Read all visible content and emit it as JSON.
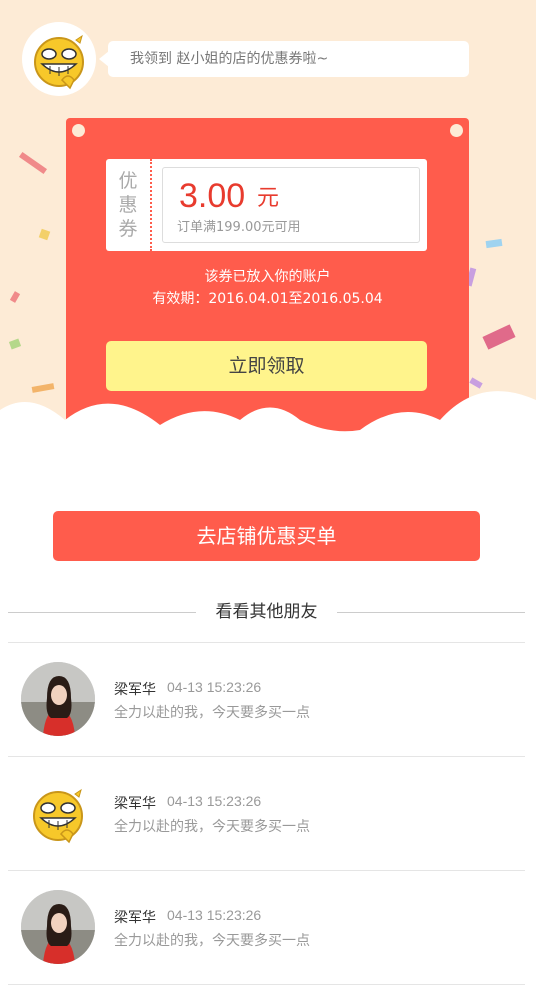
{
  "header": {
    "bubble_text": "我领到 赵小姐的店的优惠券啦~",
    "avatar_icon": "grinning-emoji-icon"
  },
  "coupon": {
    "side_label": [
      "优",
      "惠",
      "券"
    ],
    "amount": "3.00",
    "unit": "元",
    "condition": "订单满199.00元可用",
    "added_text": "该券已放入你的账户",
    "validity": "有效期：2016.04.01至2016.05.04",
    "claim_label": "立即领取"
  },
  "shop_button": {
    "label": "去店铺优惠买单"
  },
  "friends": {
    "title": "看看其他朋友",
    "items": [
      {
        "name": "梁军华",
        "time": "04-13 15:23:26",
        "message": "全力以赴的我，今天要多买一点",
        "avatar": "photo-avatar-icon"
      },
      {
        "name": "梁军华",
        "time": "04-13 15:23:26",
        "message": "全力以赴的我，今天要多买一点",
        "avatar": "grinning-emoji-icon"
      },
      {
        "name": "梁军华",
        "time": "04-13 15:23:26",
        "message": "全力以赴的我，今天要多买一点",
        "avatar": "photo-avatar-icon"
      }
    ]
  },
  "colors": {
    "background_peach": "#fdebd6",
    "card_red": "#ff5c4c",
    "amount_red": "#e83b2e",
    "claim_yellow": "#fff48c"
  }
}
